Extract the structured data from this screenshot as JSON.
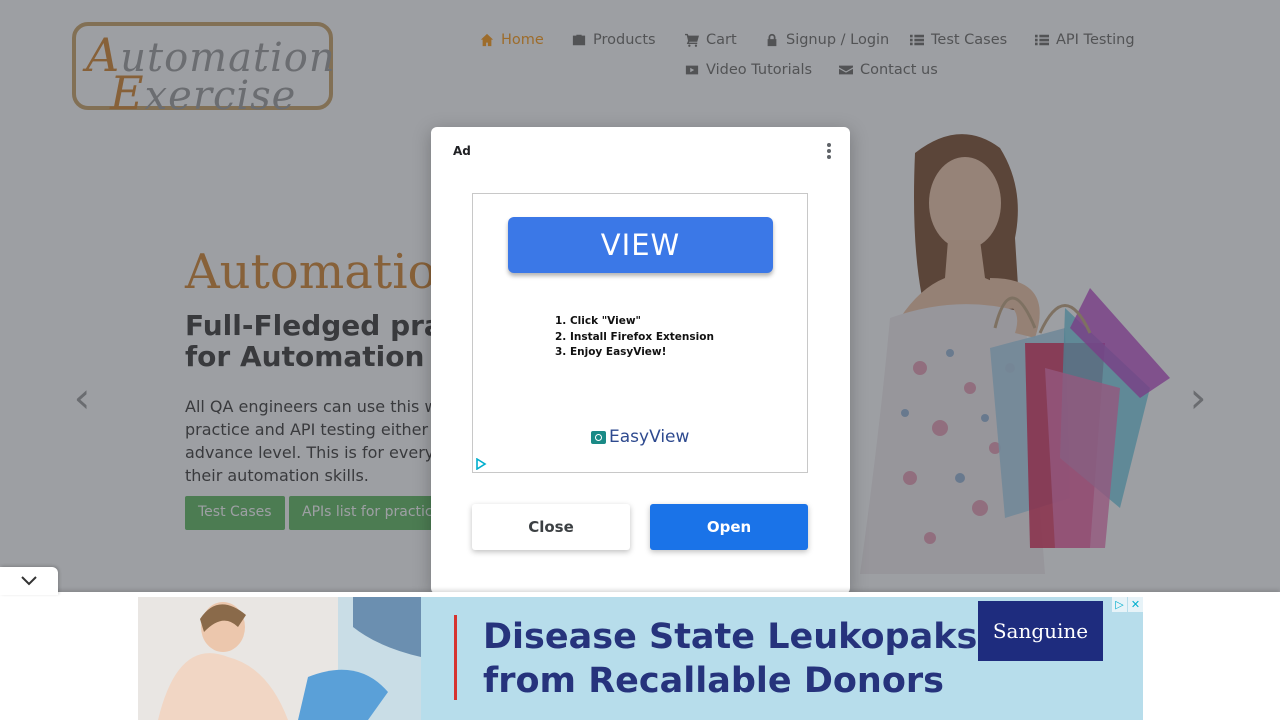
{
  "logo": {
    "line1_cap": "A",
    "line1_rest": "utomation",
    "line2_cap": "E",
    "line2_rest": "xercise"
  },
  "nav": {
    "items": [
      {
        "label": "Home",
        "icon": "home-icon",
        "active": true
      },
      {
        "label": "Products",
        "icon": "briefcase-icon"
      },
      {
        "label": "Cart",
        "icon": "cart-icon"
      },
      {
        "label": "Signup / Login",
        "icon": "lock-icon"
      },
      {
        "label": "Test Cases",
        "icon": "list-icon"
      },
      {
        "label": "API Testing",
        "icon": "list-icon"
      },
      {
        "label": "Video Tutorials",
        "icon": "youtube-icon"
      },
      {
        "label": "Contact us",
        "icon": "envelope-icon"
      }
    ],
    "active_color": "#fe980f"
  },
  "hero": {
    "title": "Automatio",
    "subtitle_line1": "Full-Fledged pra",
    "subtitle_line2": "for Automation",
    "desc_line1": "All QA engineers can use this w",
    "desc_line2": "practice and API testing either",
    "desc_line3": "advance level. This is for every",
    "desc_line4": "their automation skills.",
    "btn_test_cases": "Test Cases",
    "btn_apis": "APIs list for practic",
    "prev_arrow": "‹",
    "next_arrow": "›"
  },
  "ad_dialog": {
    "ad_label": "Ad",
    "view_button": "VIEW",
    "steps": [
      "1. Click \"View\"",
      "2. Install Firefox Extension",
      "3. Enjoy EasyView!"
    ],
    "brand": "EasyView",
    "close_label": "Close",
    "open_label": "Open"
  },
  "banner": {
    "headline_line1": "Disease State Leukopaks",
    "headline_line2": "from Recallable Donors",
    "brand": "Sanguine"
  },
  "colors": {
    "accent_orange": "#d3822b",
    "green": "#5cb85c",
    "open_blue": "#1a73e8",
    "view_blue": "#3b78e7"
  }
}
